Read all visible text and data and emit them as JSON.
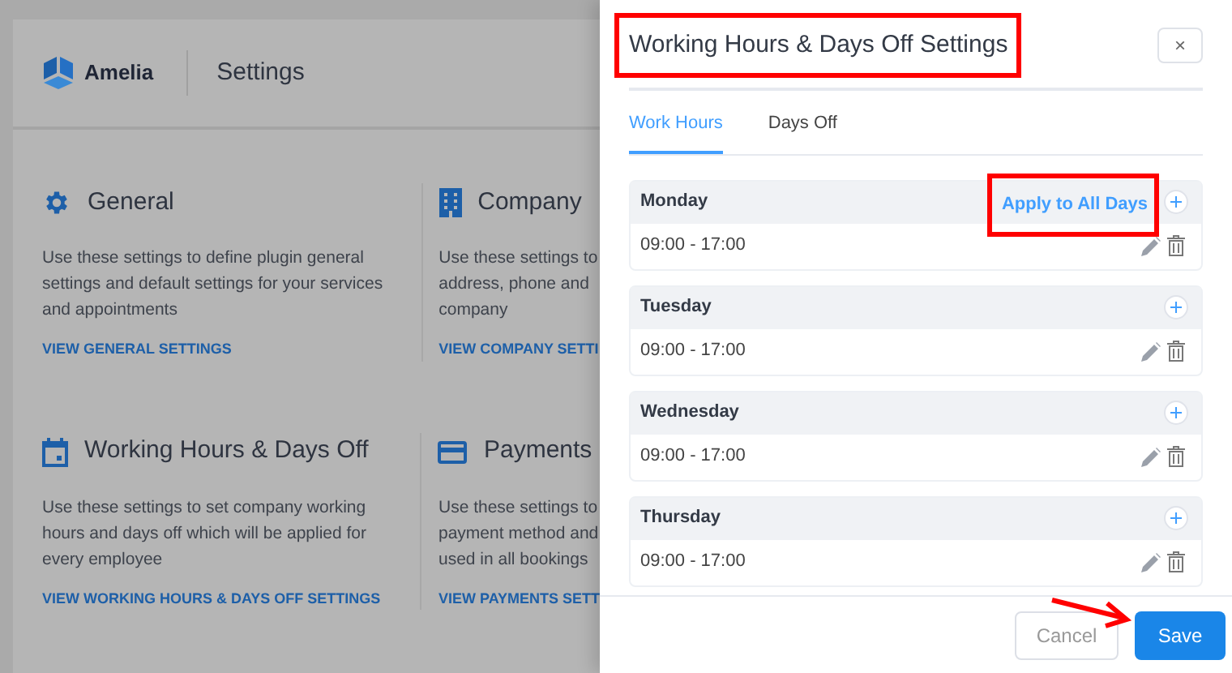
{
  "background": {
    "brand": "Amelia",
    "page_title": "Settings",
    "cards": [
      {
        "kind": "gear",
        "title": "General",
        "description": "Use these settings to define plugin general settings and default settings for your services and appointments",
        "link": "VIEW GENERAL SETTINGS"
      },
      {
        "kind": "building",
        "title": "Company",
        "description": "Use these settings to\naddress, phone and\ncompany",
        "link": "VIEW COMPANY SETTI"
      },
      {
        "kind": "calendar",
        "title": "Working Hours & Days Off",
        "description": "Use these settings to set company working hours and days off which will be applied for every employee",
        "link": "VIEW WORKING HOURS & DAYS OFF SETTINGS"
      },
      {
        "kind": "card",
        "title": "Payments",
        "description": "Use these settings to\npayment method and\nused in all bookings",
        "link": "VIEW PAYMENTS SETT"
      }
    ]
  },
  "dialog": {
    "title": "Working Hours & Days Off Settings",
    "close": "×",
    "tabs": [
      {
        "label": "Work Hours",
        "selected": true
      },
      {
        "label": "Days Off",
        "selected": false
      }
    ],
    "apply_all": "Apply to All Days",
    "days": [
      {
        "name": "Monday",
        "intervals": [
          "09:00 - 17:00"
        ]
      },
      {
        "name": "Tuesday",
        "intervals": [
          "09:00 - 17:00"
        ]
      },
      {
        "name": "Wednesday",
        "intervals": [
          "09:00 - 17:00"
        ]
      },
      {
        "name": "Thursday",
        "intervals": [
          "09:00 - 17:00"
        ]
      }
    ],
    "buttons": [
      {
        "label": "Cancel",
        "kind": "secondary"
      },
      {
        "label": "Save",
        "kind": "primary"
      }
    ]
  }
}
